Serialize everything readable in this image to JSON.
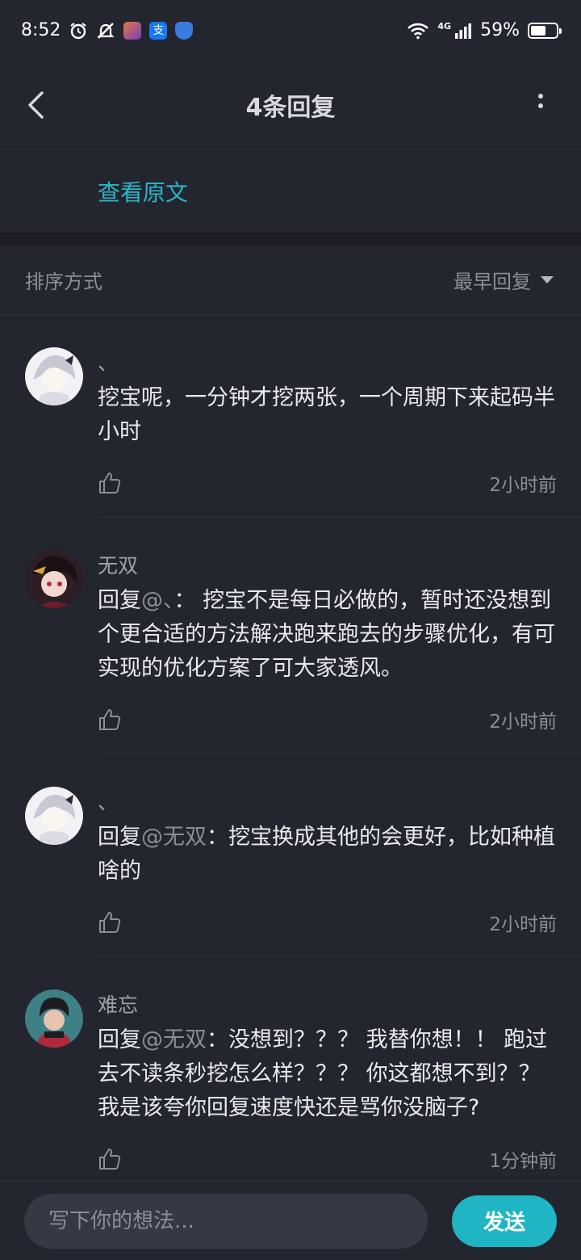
{
  "status_bar": {
    "time": "8:52",
    "network": "4G",
    "battery": "59%",
    "battery_level": 0.59
  },
  "header": {
    "title": "4条回复",
    "back_icon": "chevron-left-icon",
    "more_icon": "more-vertical-icon"
  },
  "original": {
    "link_label": "查看原文"
  },
  "sort": {
    "label": "排序方式",
    "selected": "最早回复"
  },
  "replies": [
    {
      "name": "、",
      "prefix": "",
      "mention": "",
      "text": "挖宝呢，一分钟才挖两张，一个周期下来起码半小时",
      "time": "2小时前"
    },
    {
      "name": "无双",
      "prefix": "回复",
      "mention": "@、",
      "text": "：  挖宝不是每日必做的，暂时还没想到个更合适的方法解决跑来跑去的步骤优化，有可实现的优化方案了可大家透风。",
      "time": "2小时前"
    },
    {
      "name": "、",
      "prefix": "回复",
      "mention": "@无双",
      "text": "：挖宝换成其他的会更好，比如种植啥的",
      "time": "2小时前"
    },
    {
      "name": "难忘",
      "prefix": "回复",
      "mention": "@无双",
      "text": "：没想到？？？ 我替你想！！ 跑过去不读条秒挖怎么样？？？ 你这都想不到？？我是该夸你回复速度快还是骂你没脑子?",
      "time": "1分钟前"
    }
  ],
  "composer": {
    "placeholder": "写下你的想法...",
    "send_label": "发送"
  },
  "colors": {
    "background": "#23252f",
    "accent": "#1fb5c4",
    "link": "#2ab6c6"
  }
}
